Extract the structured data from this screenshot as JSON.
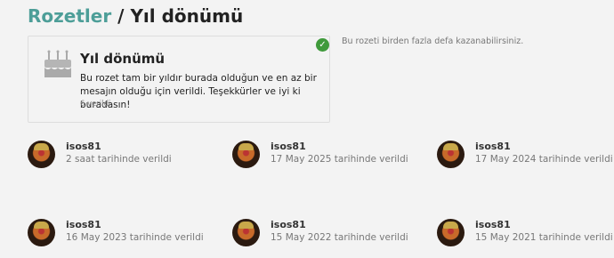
{
  "header": {
    "crumb": "Rozetler",
    "separator": "/",
    "current": "Yıl dönümü"
  },
  "badge": {
    "icon": "birthday-cake-icon",
    "name": "Yıl dönümü",
    "description": "Bu rozet tam bir yıldır burada olduğun ve en az bir mesajın olduğu için verildi. Teşekkürler ve iyi ki buradasın!",
    "granted_count": "6 verildi",
    "status_icon": "check-circle-icon",
    "note": "Bu rozeti birden fazla defa kazanabilirsiniz."
  },
  "grants": [
    {
      "username": "isos81",
      "date": "2 saat tarihinde verildi"
    },
    {
      "username": "isos81",
      "date": "17 May 2025 tarihinde verildi"
    },
    {
      "username": "isos81",
      "date": "17 May 2024 tarihinde verildi"
    },
    {
      "username": "isos81",
      "date": "16 May 2023 tarihinde verildi"
    },
    {
      "username": "isos81",
      "date": "15 May 2022 tarihinde verildi"
    },
    {
      "username": "isos81",
      "date": "15 May 2021 tarihinde verildi"
    }
  ]
}
